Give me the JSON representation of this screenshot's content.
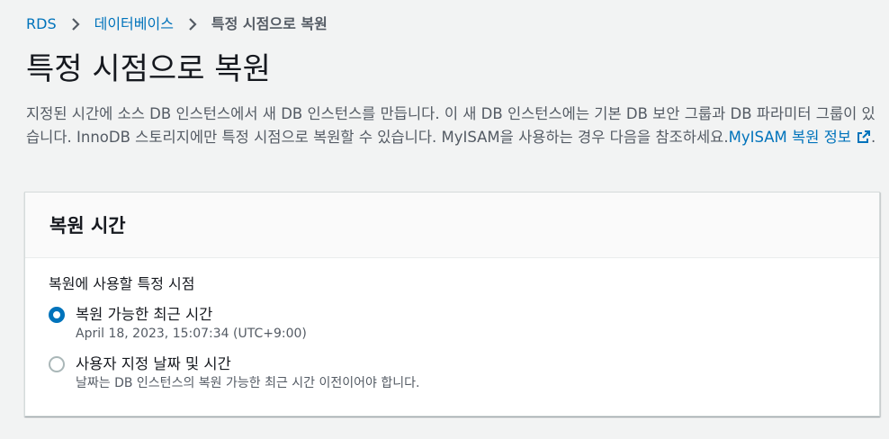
{
  "breadcrumb": {
    "items": [
      {
        "label": "RDS"
      },
      {
        "label": "데이터베이스"
      },
      {
        "label": "특정 시점으로 복원"
      }
    ]
  },
  "page": {
    "title": "특정 시점으로 복원",
    "description_text": "지정된 시간에 소스 DB 인스턴스에서 새 DB 인스턴스를 만듭니다. 이 새 DB 인스턴스에는 기본 DB 보안 그룹과 DB 파라미터 그룹이 있습니다. InnoDB 스토리지에만 특정 시점으로 복원할 수 있습니다. MyISAM을 사용하는 경우 다음을 참조하세요.",
    "description_link": "MyISAM 복원 정보",
    "description_end": ".",
    "external_link_icon": "external-link-icon"
  },
  "panel": {
    "title": "복원 시간",
    "field_label": "복원에 사용할 특정 시점",
    "options": [
      {
        "label": "복원 가능한 최근 시간",
        "description": "April 18, 2023, 15:07:34 (UTC+9:00)",
        "selected": true
      },
      {
        "label": "사용자 지정 날짜 및 시간",
        "description": "날짜는 DB 인스턴스의 복원 가능한 최근 시간 이전이어야 합니다.",
        "selected": false
      }
    ]
  },
  "colors": {
    "link": "#0073bb",
    "background": "#f2f3f3",
    "radio_selected": "#0073bb"
  }
}
